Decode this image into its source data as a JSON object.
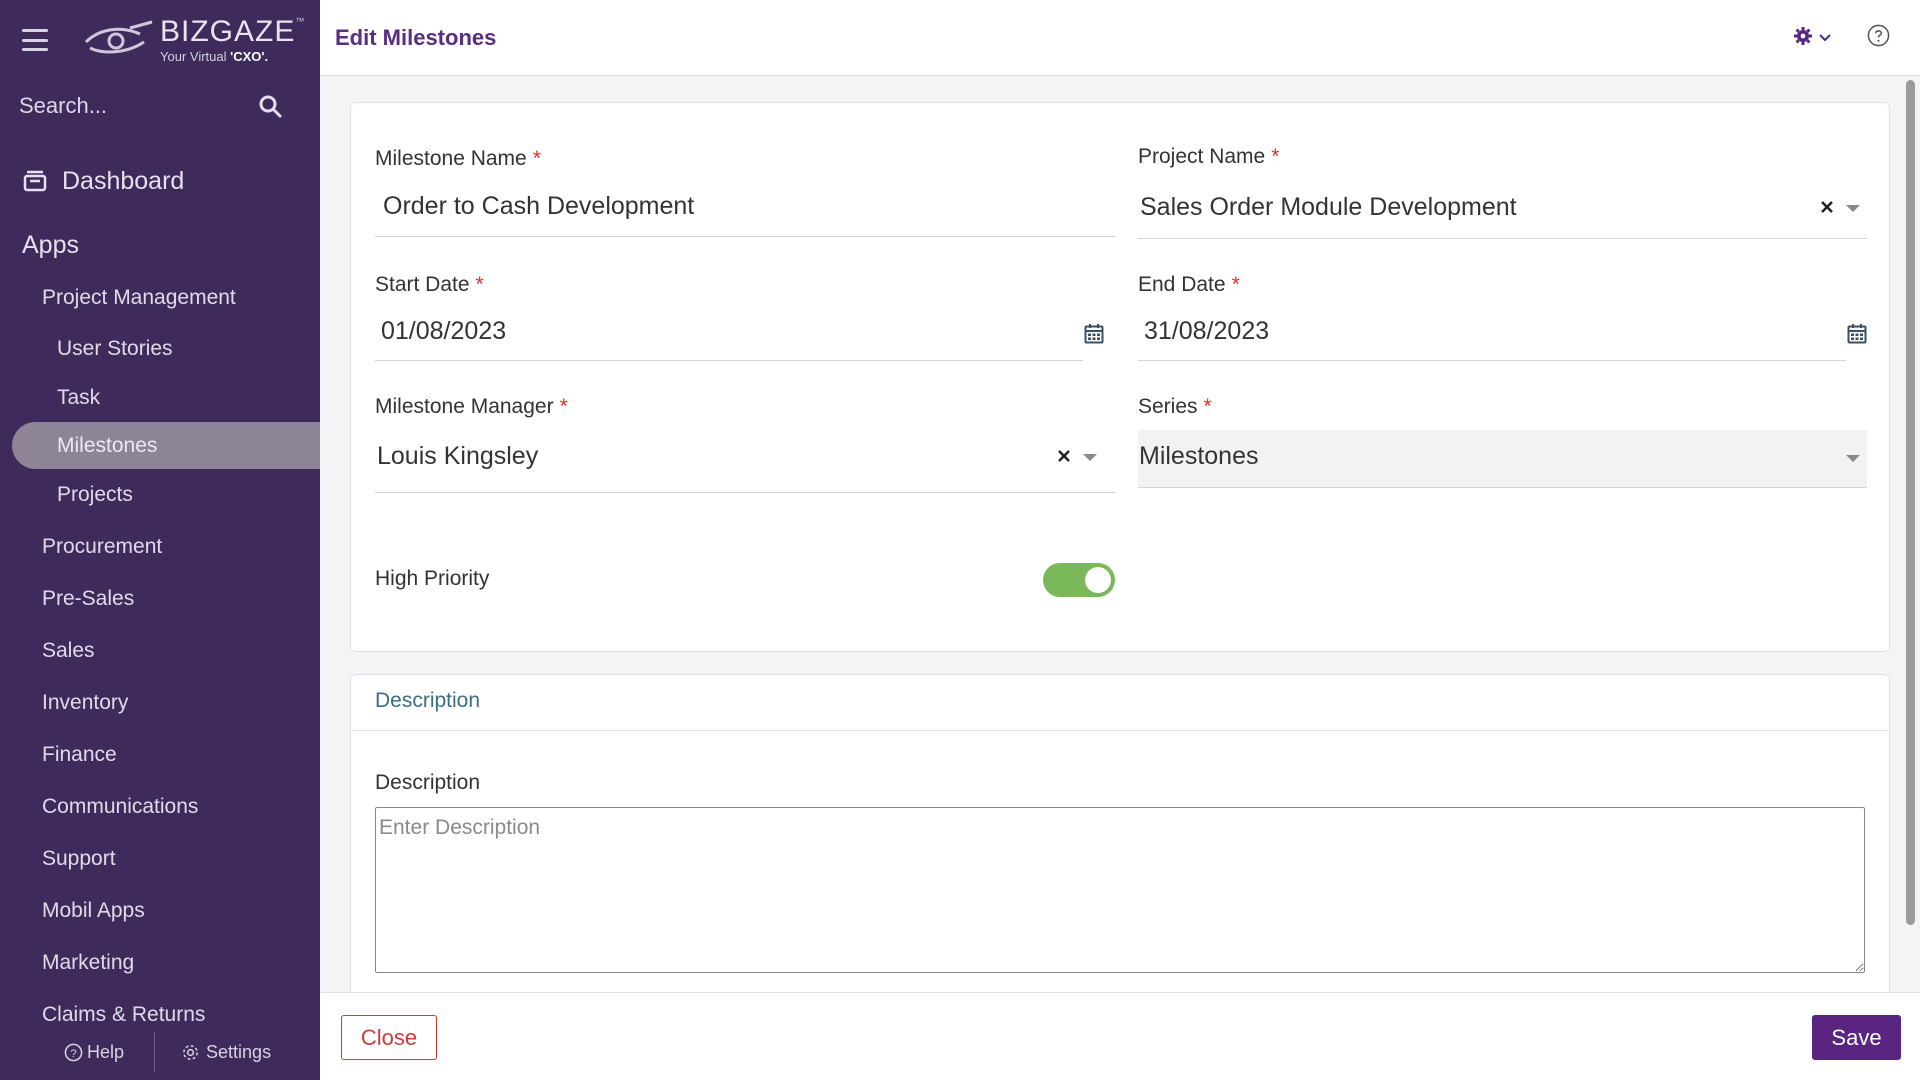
{
  "sidebar": {
    "logo": {
      "brand": "BIZGAZE",
      "tm": "™",
      "tagline_pre": "Your Virtual ",
      "tagline_bold": "'CXO'."
    },
    "search_placeholder": "Search...",
    "dashboard": "Dashboard",
    "apps": "Apps",
    "nav": [
      {
        "label": "Project Management"
      },
      {
        "label": "User Stories"
      },
      {
        "label": "Task"
      },
      {
        "label": "Milestones"
      },
      {
        "label": "Projects"
      },
      {
        "label": "Procurement"
      },
      {
        "label": "Pre-Sales"
      },
      {
        "label": "Sales"
      },
      {
        "label": "Inventory"
      },
      {
        "label": "Finance"
      },
      {
        "label": "Communications"
      },
      {
        "label": "Support"
      },
      {
        "label": "Mobil Apps"
      },
      {
        "label": "Marketing"
      },
      {
        "label": "Claims & Returns"
      }
    ],
    "footer": {
      "help": "Help",
      "settings": "Settings"
    }
  },
  "header": {
    "title": "Edit Milestones"
  },
  "form": {
    "milestone_name": {
      "label": "Milestone Name",
      "value": "Order to Cash Development"
    },
    "project_name": {
      "label": "Project Name",
      "value": "Sales Order Module Development"
    },
    "start_date": {
      "label": "Start Date",
      "value": "01/08/2023"
    },
    "end_date": {
      "label": "End Date",
      "value": "31/08/2023"
    },
    "milestone_manager": {
      "label": "Milestone Manager",
      "value": "Louis Kingsley"
    },
    "series": {
      "label": "Series",
      "value": "Milestones"
    },
    "high_priority": {
      "label": "High Priority",
      "on": true
    },
    "required_mark": "*"
  },
  "description_section": {
    "title": "Description",
    "field_label": "Description",
    "placeholder": "Enter Description",
    "value": ""
  },
  "footer": {
    "close": "Close",
    "save": "Save"
  },
  "colors": {
    "sidebar_bg": "#3f2b5b",
    "accent": "#5a2580",
    "toggle_on": "#7ab85a",
    "required": "#e0332f",
    "close_border": "#d23a3a"
  }
}
